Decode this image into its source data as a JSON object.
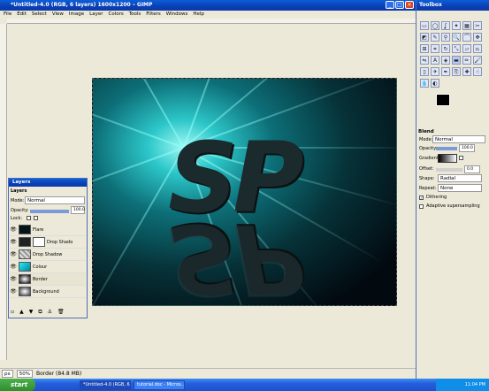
{
  "window": {
    "title": "*Untitled-4.0 (RGB, 6 layers) 1600x1200 – GIMP"
  },
  "menubar": {
    "items": [
      "File",
      "Edit",
      "Select",
      "View",
      "Image",
      "Layer",
      "Colors",
      "Tools",
      "Filters",
      "Windows",
      "Help"
    ]
  },
  "artwork": {
    "text": "SP"
  },
  "status": {
    "unit": "px",
    "zoom": "50%",
    "message": "Border (84.8 MB)"
  },
  "layers_panel": {
    "title": "Layers",
    "tab": "Layers",
    "mode_label": "Mode:",
    "mode_value": "Normal",
    "opacity_label": "Opacity:",
    "opacity_value": "100.0",
    "lock_label": "Lock:",
    "layers": [
      {
        "name": "Flare"
      },
      {
        "name": "Drop Shado"
      },
      {
        "name": "Drop Shadow"
      },
      {
        "name": "Colour"
      },
      {
        "name": "Border"
      },
      {
        "name": "Background"
      }
    ]
  },
  "toolbox": {
    "title": "Toolbox",
    "tool_options_title": "Blend",
    "mode_label": "Mode:",
    "mode_value": "Normal",
    "opacity_label": "Opacity:",
    "opacity_value": "100.0",
    "gradient_label": "Gradient:",
    "offset_label": "Offset:",
    "offset_value": "0.0",
    "shape_label": "Shape:",
    "shape_value": "Radial",
    "repeat_label": "Repeat:",
    "repeat_value": "None",
    "dithering_label": "Dithering",
    "adaptive_label": "Adaptive supersampling"
  },
  "taskbar": {
    "start": "start",
    "tasks": [
      "*Untitled-4.0 (RGB, 6...",
      "tutorial.doc - Micros..."
    ],
    "clock": "11:04 PM"
  },
  "colors": {
    "accent": "#0a5fd8",
    "art_glow": "#2cc7c9"
  }
}
